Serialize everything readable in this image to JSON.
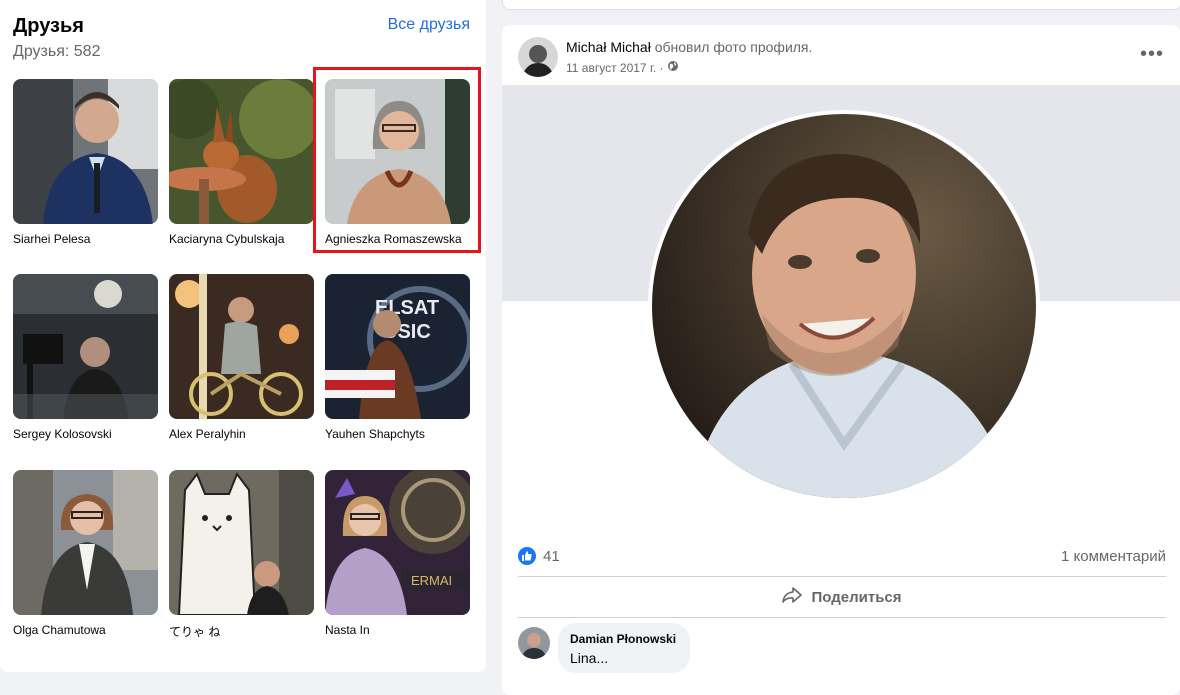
{
  "friends": {
    "title": "Друзья",
    "count_text": "Друзья: 582",
    "all_link": "Все друзья",
    "list": [
      {
        "name": "Siarhei Pelesa"
      },
      {
        "name": "Kaciaryna Cybulskaja"
      },
      {
        "name": "Agnieszka Romaszewska"
      },
      {
        "name": "Sergey Kolosovski"
      },
      {
        "name": "Alex Peralyhin"
      },
      {
        "name": "Yauhen Shapchyts"
      },
      {
        "name": "Olga Chamutowa"
      },
      {
        "name": "てりゃ ね"
      },
      {
        "name": "Nasta In"
      }
    ]
  },
  "post": {
    "author": "Michał Michał",
    "action": "обновил фото профиля.",
    "date": "11 август 2017 г. ·",
    "more_icon": "more-horizontal-icon",
    "likes": "41",
    "comments": "1 комментарий",
    "share_label": "Поделиться",
    "comment": {
      "author": "Damian Płonowski",
      "text": "Lina..."
    }
  },
  "colors": {
    "accent": "#216fdb",
    "like": "#1877f2",
    "highlight": "#e8141b"
  }
}
